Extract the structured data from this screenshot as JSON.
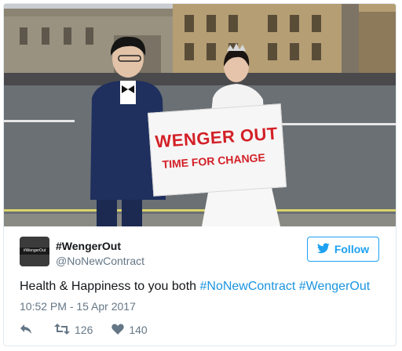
{
  "banner": {
    "line1": "WENGER OUT",
    "line2": "TIME FOR CHANGE"
  },
  "user": {
    "display_name": "#WengerOut",
    "handle": "@NoNewContract",
    "avatar_text": "#WengerOut"
  },
  "follow_button": {
    "label": "Follow",
    "icon": "twitter-bird-icon"
  },
  "tweet": {
    "text_prefix": "Health & Happiness to you both ",
    "hashtag1": "#NoNewContract",
    "hashtag2": "#WengerOut",
    "timestamp": "10:52 PM - 15 Apr 2017"
  },
  "actions": {
    "reply_icon": "reply-icon",
    "retweet_icon": "retweet-icon",
    "retweet_count": "126",
    "like_icon": "heart-icon",
    "like_count": "140"
  },
  "colors": {
    "link": "#1b95e0",
    "follow_accent": "#1da1f2",
    "banner_text": "#d32027",
    "secondary_text": "#657786"
  }
}
